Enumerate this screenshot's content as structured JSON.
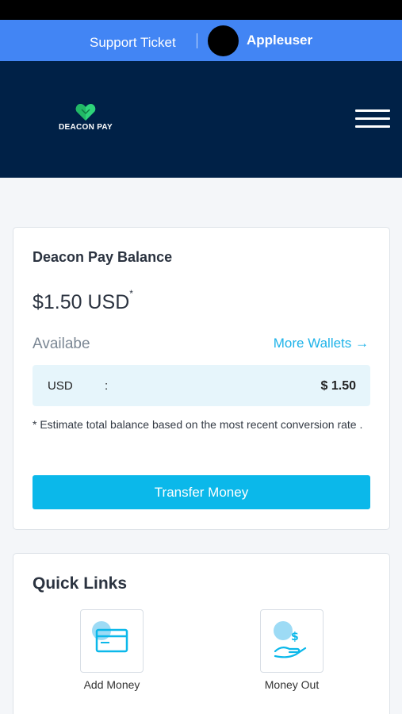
{
  "header": {
    "support_link": "Support Ticket",
    "username": "Appleuser"
  },
  "navbar": {
    "logo_text": "DEACON PAY"
  },
  "balance_card": {
    "title": "Deacon Pay Balance",
    "amount": "$1.50 USD",
    "amount_marker": "*",
    "available_label": "Availabe",
    "more_wallets_link": "More Wallets →",
    "currency_code": "USD",
    "separator": ":",
    "currency_value": "$ 1.50",
    "note": "* Estimate total balance based on the most recent conversion rate .",
    "transfer_button": "Transfer Money"
  },
  "quick_links": {
    "title": "Quick Links",
    "items": [
      {
        "label": "Add Money",
        "icon": "card-icon"
      },
      {
        "label": "Money Out",
        "icon": "hand-dollar-icon"
      }
    ]
  },
  "colors": {
    "top_strip": "#4285f4",
    "navbar": "#002147",
    "accent": "#0bb8ea",
    "currency_row_bg": "#e6f5fb",
    "logo_green": "#2ed47a"
  }
}
